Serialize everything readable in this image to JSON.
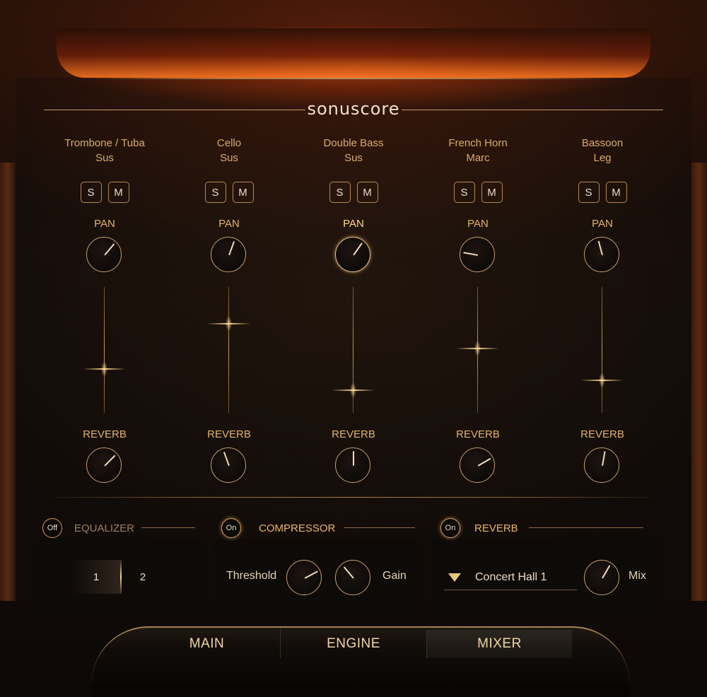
{
  "logo": "sonuscore",
  "channels": [
    {
      "name": "Trombone / Tuba",
      "articulation": "Sus",
      "solo": "S",
      "mute": "M",
      "pan_label": "PAN",
      "reverb_label": "REVERB",
      "pan_angle": 40,
      "reverb_angle": 45,
      "fader_pos": 0.65
    },
    {
      "name": "Cello",
      "articulation": "Sus",
      "solo": "S",
      "mute": "M",
      "pan_label": "PAN",
      "reverb_label": "REVERB",
      "pan_angle": 20,
      "reverb_angle": -20,
      "fader_pos": 0.29
    },
    {
      "name": "Double Bass",
      "articulation": "Sus",
      "solo": "S",
      "mute": "M",
      "pan_label": "PAN",
      "reverb_label": "REVERB",
      "pan_angle": 35,
      "reverb_angle": 0,
      "fader_pos": 0.82
    },
    {
      "name": "French Horn",
      "articulation": "Marc",
      "solo": "S",
      "mute": "M",
      "pan_label": "PAN",
      "reverb_label": "REVERB",
      "pan_angle": -80,
      "reverb_angle": 60,
      "fader_pos": 0.49
    },
    {
      "name": "Bassoon",
      "articulation": "Leg",
      "solo": "S",
      "mute": "M",
      "pan_label": "PAN",
      "reverb_label": "REVERB",
      "pan_angle": -15,
      "reverb_angle": 10,
      "fader_pos": 0.74
    }
  ],
  "equalizer": {
    "power": "Off",
    "title": "EQUALIZER",
    "band1": "1",
    "band2": "2"
  },
  "compressor": {
    "power": "On",
    "title": "COMPRESSOR",
    "threshold_label": "Threshold",
    "gain_label": "Gain",
    "threshold_angle": 62,
    "gain_angle": -40
  },
  "reverb": {
    "power": "On",
    "title": "REVERB",
    "preset": "Concert Hall 1",
    "mix_label": "Mix",
    "mix_angle": 30
  },
  "nav": {
    "main": "MAIN",
    "engine": "ENGINE",
    "mixer": "MIXER",
    "active": "MIXER"
  },
  "colors": {
    "accent": "#d8b070",
    "glow": "#ffd890",
    "background": "#0c0806"
  }
}
